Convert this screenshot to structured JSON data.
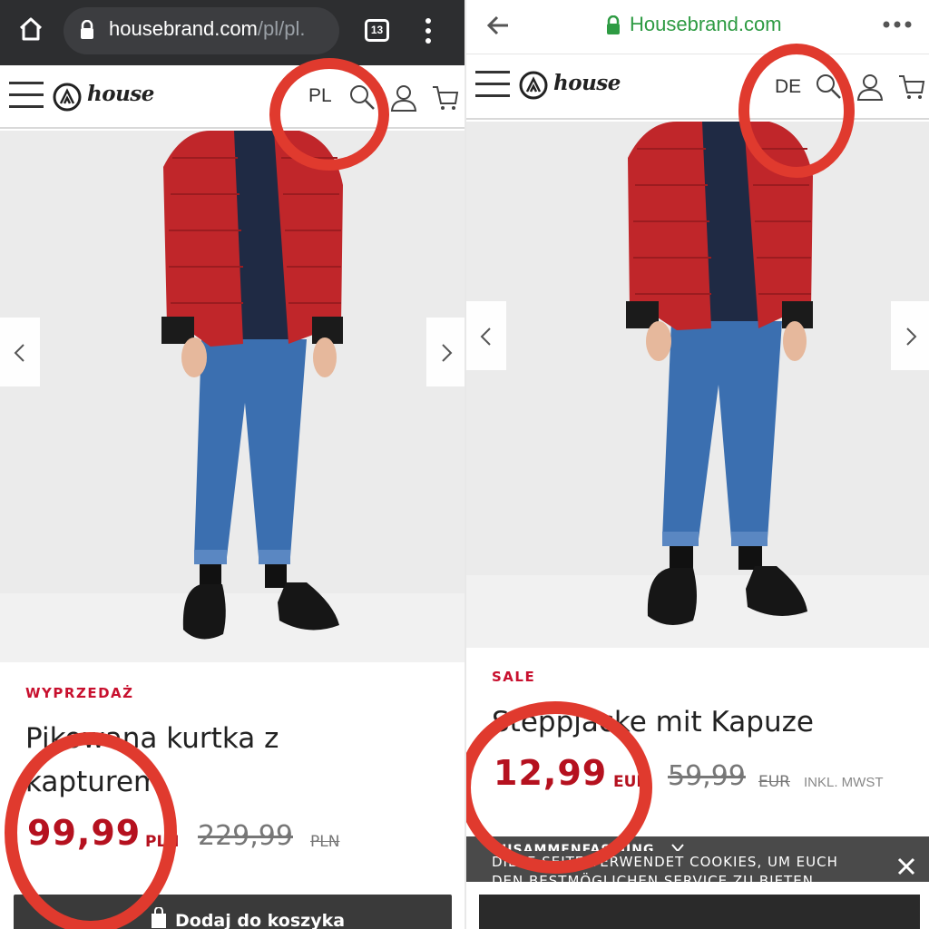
{
  "left": {
    "browser": {
      "url_host": "housebrand.com",
      "url_path": "/pl/pl.",
      "tab_count": "13"
    },
    "header": {
      "brand": "house",
      "country": "PL"
    },
    "product": {
      "sale_label": "WYPRZEDAŻ",
      "title_line1": "Pikowana kurtka z",
      "title_line2": "kapturem",
      "price": "99,99",
      "currency": "PLN",
      "old_price": "229,99",
      "old_currency": "PLN"
    },
    "cta": {
      "label": "Dodaj do koszyka"
    }
  },
  "right": {
    "browser": {
      "title": "Housebrand.com"
    },
    "header": {
      "brand": "house",
      "country": "DE"
    },
    "product": {
      "sale_label": "SALE",
      "title": "Steppjacke mit Kapuze",
      "price": "12,99",
      "currency": "EUR",
      "old_price": "59,99",
      "old_currency": "EUR",
      "vat_note": "INKL. MWST"
    },
    "summary": {
      "label": "ZUSAMMENFASSUNG"
    },
    "cookie": {
      "text": "DIESE SEITE VERWENDET COOKIES, UM EUCH DEN BESTMÖGLICHEN SERVICE ZU BIETEN"
    }
  },
  "colors": {
    "sale_red": "#b5111f",
    "annotation_red": "#e03a2e",
    "secure_green": "#2e9b43"
  },
  "icons": [
    "home-icon",
    "lock-icon",
    "menu-icon",
    "search-icon",
    "user-icon",
    "cart-icon",
    "back-arrow-icon",
    "more-icon",
    "chevron-left-icon",
    "chevron-right-icon",
    "close-icon",
    "shopping-bag-icon"
  ]
}
